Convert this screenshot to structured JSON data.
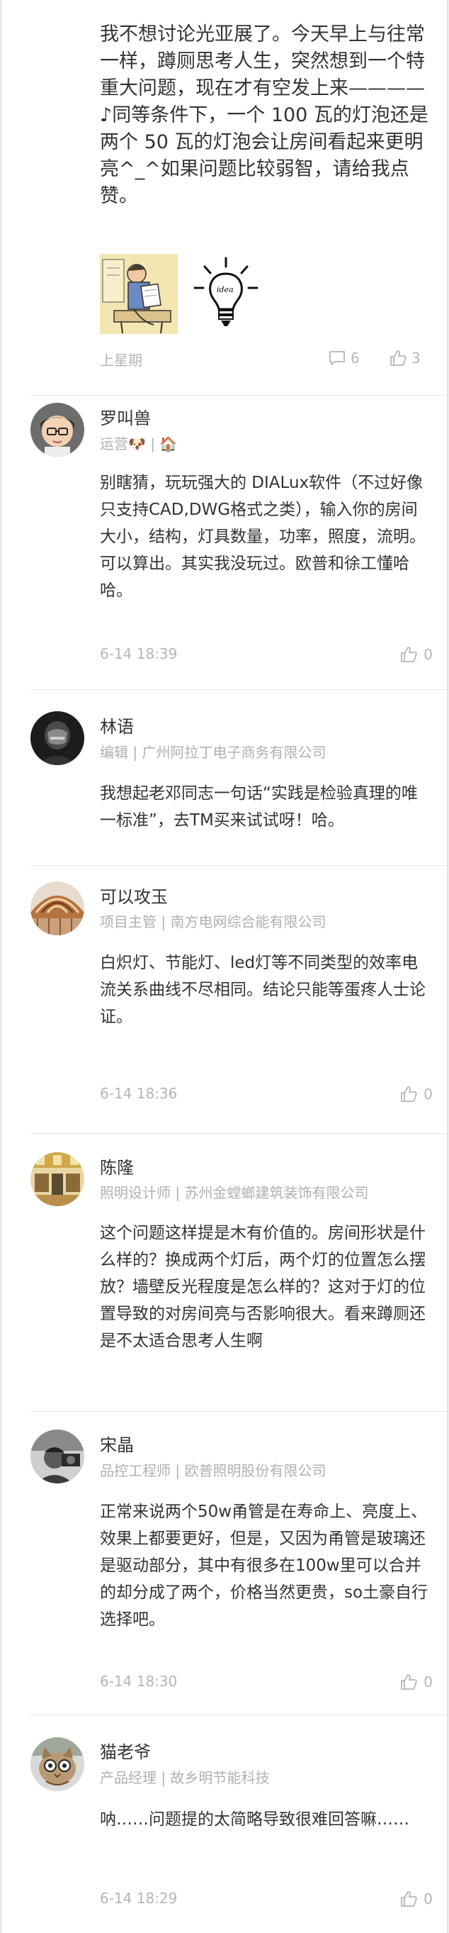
{
  "post": {
    "body": "我不想讨论光亚展了。今天早上与往常一样，蹲厕思考人生，突然想到一个特重大问题，现在才有空发上来————♪同等条件下，一个 100 瓦的灯泡还是两个 50 瓦的灯泡会让房间看起来更明亮^_^如果问题比较弱智，请给我点赞。",
    "time": "上星期",
    "comment_count": "6",
    "like_count": "3",
    "images": [
      "reading-cartoon",
      "idea-bulb"
    ]
  },
  "comments": [
    {
      "name": "罗叫兽",
      "subtitle": "运营🐶 | 🏠",
      "text": "别瞎猜，玩玩强大的 DIALux软件（不过好像只支持CAD,DWG格式之类），输入你的房间大小，结构，灯具数量，功率，照度，流明。可以算出。其实我没玩过。欧普和徐工懂哈哈。",
      "time": "6-14 18:39",
      "likes": "0"
    },
    {
      "name": "林语",
      "subtitle": "编辑 | 广州阿拉丁电子商务有限公司",
      "text": "我想起老邓同志一句话“实践是检验真理的唯一标准”，去TM买来试试呀！哈。",
      "time": "",
      "likes": ""
    },
    {
      "name": "可以攻玉",
      "subtitle": "项目主管 | 南方电网综合能有限公司",
      "text": "白炽灯、节能灯、led灯等不同类型的效率电流关系曲线不尽相同。结论只能等蛋疼人士论证。",
      "time": "6-14 18:36",
      "likes": "0"
    },
    {
      "name": "陈隆",
      "subtitle": "照明设计师 | 苏州金螳螂建筑装饰有限公司",
      "text": "这个问题这样提是木有价值的。房间形状是什么样的？换成两个灯后，两个灯的位置怎么摆放？墙壁反光程度是怎么样的？这对于灯的位置导致的对房间亮与否影响很大。看来蹲厕还是不太适合思考人生啊",
      "time": "",
      "likes": ""
    },
    {
      "name": "宋晶",
      "subtitle": "品控工程师 | 欧普照明股份有限公司",
      "text": "正常来说两个50w甬管是在寿命上、亮度上、效果上都要更好，但是，又因为甬管是玻璃还是驱动部分，其中有很多在100w里可以合并的却分成了两个，价格当然更贵，so土豪自行选择吧。",
      "time": "6-14 18:30",
      "likes": "0"
    },
    {
      "name": "猫老爷",
      "subtitle": "产品经理 | 故乡明节能科技",
      "text": "呐……问题提的太简略导致很难回答嘛……",
      "time": "6-14 18:29",
      "likes": "0"
    }
  ],
  "colors": {
    "text": "#333333",
    "muted": "#b5b5b5",
    "divider": "#e6e6e6"
  }
}
